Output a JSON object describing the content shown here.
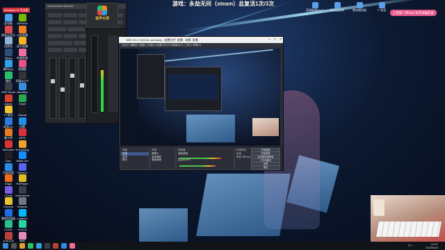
{
  "banner": {
    "title": "游戏：永劫无间（steam）总复活1次/3次"
  },
  "tags": {
    "top_left": "Windows 11 专业版",
    "pill": "上周第一梦babi 本月未破纪录"
  },
  "desktop_icons_left": [
    {
      "label": "此电脑",
      "color": "#4aa3e6"
    },
    {
      "label": "网易云音乐",
      "color": "#e24b4b"
    },
    {
      "label": "回收站",
      "color": "#8fb3d6"
    },
    {
      "label": "Steam",
      "color": "#2b4e7a"
    },
    {
      "label": "腾讯QQ",
      "color": "#2fa3e6"
    },
    {
      "label": "微信",
      "color": "#2bbd6a"
    },
    {
      "label": "OBS Studio",
      "color": "#3a3d48"
    },
    {
      "label": "Adobe",
      "color": "#d6402a"
    },
    {
      "label": "YY语音",
      "color": "#f2c12e"
    },
    {
      "label": "网易UU",
      "color": "#2d7be0"
    },
    {
      "label": "鲁大师",
      "color": "#e87a1f"
    },
    {
      "label": "WeGame",
      "color": "#d33"
    },
    {
      "label": "Epic",
      "color": "#222"
    },
    {
      "label": "百度网盘",
      "color": "#2a8ce6"
    },
    {
      "label": "Origin",
      "color": "#f06b1e"
    },
    {
      "label": "uTools",
      "color": "#7a5ce0"
    },
    {
      "label": "Chrome",
      "color": "#e6c22e"
    },
    {
      "label": "雷神加速器",
      "color": "#1d6de0"
    },
    {
      "label": "KOOK",
      "color": "#27c08f"
    },
    {
      "label": "永劫无间",
      "color": "#b8413a"
    },
    {
      "label": "GeForce",
      "color": "#76b900"
    },
    {
      "label": "斗鱼直播",
      "color": "#f07e23"
    },
    {
      "label": "虎牙直播",
      "color": "#f5b222"
    },
    {
      "label": "哔哩哔哩",
      "color": "#f06e9c"
    },
    {
      "label": "直播姬",
      "color": "#e8518a"
    },
    {
      "label": "网易BUFF",
      "color": "#333"
    },
    {
      "label": "Bandizip",
      "color": "#3a8ddc"
    },
    {
      "label": "XSplit",
      "color": "#2ba64c"
    },
    {
      "label": "Ubisoft",
      "color": "#1b1b1b"
    },
    {
      "label": "迅雷",
      "color": "#1f8fe8"
    },
    {
      "label": "WPS",
      "color": "#d9303e"
    },
    {
      "label": "Everything",
      "color": "#f0a22a"
    },
    {
      "label": "Battle.net",
      "color": "#148eff"
    },
    {
      "label": "Discord",
      "color": "#5865f2"
    },
    {
      "label": "PotPlayer",
      "color": "#e0ba24"
    },
    {
      "label": "Voicemeeter",
      "color": "#3b3e46"
    },
    {
      "label": "VMware",
      "color": "#707780"
    },
    {
      "label": "Logitech",
      "color": "#00b8fc"
    },
    {
      "label": "GoXLR",
      "color": "#2ad6a0"
    },
    {
      "label": "美颜",
      "color": "#e38bb6"
    }
  ],
  "desktop_icons_right": [
    {
      "label": "英雄联盟WeGame"
    },
    {
      "label": "网易云游戏"
    },
    {
      "label": "雷电模拟器"
    },
    {
      "label": "TT语音"
    }
  ],
  "mixer": {
    "title": "Voicemeeter Banana",
    "logo_text": "音声大师"
  },
  "obs": {
    "title": "OBS 29.1.3 (64-bit, windows) - 配置文件: 直播 - 场景: 直播",
    "menu": "文件(F)  编辑(E)  视图(V)  停靠(D)  配置文件(P)  场景集合(S)  工具(T)  帮助(H)",
    "docks": {
      "scenes": {
        "header": "场景",
        "items": [
          "直播",
          "游戏",
          "聊天"
        ]
      },
      "sources": {
        "header": "来源",
        "items": [
          "摄像头",
          "游戏捕获",
          "桌面音频"
        ]
      },
      "mixer": {
        "header": "混音器",
        "items": [
          "桌面音频",
          "麦克风/Aux"
        ]
      },
      "transitions": {
        "header": "转场特效",
        "items": [
          "淡出",
          "时长 300 ms"
        ]
      },
      "controls": [
        "开始直播",
        "开始录制",
        "启动虚拟摄像机",
        "工作室模式",
        "设置",
        "退出"
      ]
    }
  },
  "taskbar": {
    "time": "22:37",
    "date": "2023/8/15",
    "tray": "中 ^"
  }
}
